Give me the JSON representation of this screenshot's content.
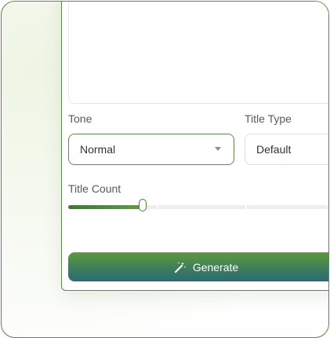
{
  "form": {
    "tone_label": "Tone",
    "tone_value": "Normal",
    "title_type_label": "Title Type",
    "title_type_value": "Default",
    "title_count_label": "Title Count",
    "title_count_fraction": 0.28,
    "generate_label": "Generate"
  },
  "icons": {
    "generate": "magic-wand-icon",
    "dropdown": "chevron-down-icon"
  },
  "colors": {
    "accent": "#5f8752",
    "button_top": "#5d9a3e",
    "button_bottom": "#2b6a7a"
  }
}
